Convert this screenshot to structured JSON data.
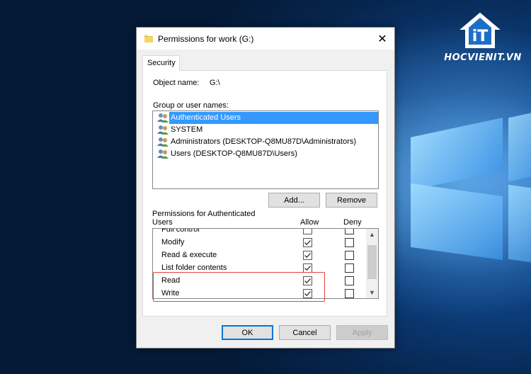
{
  "window": {
    "title": "Permissions for work (G:)",
    "close_glyph": "✕"
  },
  "tabs": [
    {
      "label": "Security"
    }
  ],
  "object": {
    "label": "Object name:",
    "value": "G:\\"
  },
  "groups": {
    "label": "Group or user names:",
    "items": [
      {
        "label": "Authenticated Users",
        "selected": true
      },
      {
        "label": "SYSTEM",
        "selected": false
      },
      {
        "label": "Administrators (DESKTOP-Q8MU87D\\Administrators)",
        "selected": false
      },
      {
        "label": "Users (DESKTOP-Q8MU87D\\Users)",
        "selected": false
      }
    ],
    "add_label": "Add...",
    "remove_label": "Remove"
  },
  "permissions": {
    "label_line1": "Permissions for Authenticated",
    "label_line2": "Users",
    "allow_header": "Allow",
    "deny_header": "Deny",
    "rows": [
      {
        "name": "Full control",
        "allow": false,
        "deny": false
      },
      {
        "name": "Modify",
        "allow": true,
        "deny": false
      },
      {
        "name": "Read & execute",
        "allow": true,
        "deny": false
      },
      {
        "name": "List folder contents",
        "allow": true,
        "deny": false
      },
      {
        "name": "Read",
        "allow": true,
        "deny": false
      },
      {
        "name": "Write",
        "allow": true,
        "deny": false
      }
    ]
  },
  "footer": {
    "ok_label": "OK",
    "cancel_label": "Cancel",
    "apply_label": "Apply"
  },
  "watermark": {
    "text": "HOCVIENIT.VN",
    "icon_text": "iT"
  },
  "colors": {
    "selection": "#3399ff",
    "highlight_box": "#e84040",
    "desktop_blue": "#0c3d7a"
  }
}
